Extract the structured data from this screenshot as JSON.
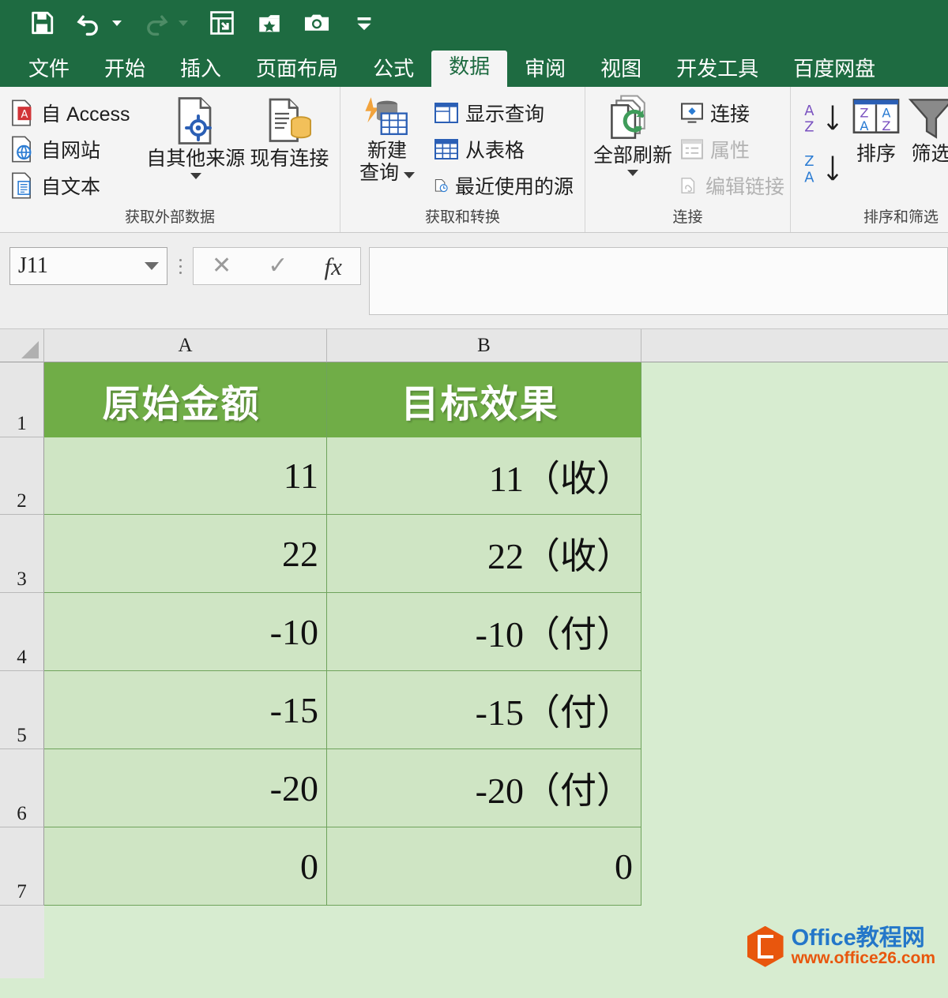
{
  "quick_access": {
    "items": [
      {
        "name": "save-icon",
        "label": "保存"
      },
      {
        "name": "undo-icon",
        "label": "撤消"
      },
      {
        "name": "redo-icon",
        "label": "恢复"
      },
      {
        "name": "export-table-icon",
        "label": "导出表格"
      },
      {
        "name": "favorites-icon",
        "label": "收藏"
      },
      {
        "name": "camera-icon",
        "label": "截图"
      },
      {
        "name": "customize-qat-icon",
        "label": "自定义快速访问工具栏"
      }
    ]
  },
  "tabs": [
    {
      "label": "文件",
      "active": false
    },
    {
      "label": "开始",
      "active": false
    },
    {
      "label": "插入",
      "active": false
    },
    {
      "label": "页面布局",
      "active": false
    },
    {
      "label": "公式",
      "active": false
    },
    {
      "label": "数据",
      "active": true
    },
    {
      "label": "审阅",
      "active": false
    },
    {
      "label": "视图",
      "active": false
    },
    {
      "label": "开发工具",
      "active": false
    },
    {
      "label": "百度网盘",
      "active": false
    }
  ],
  "ribbon": {
    "groups": [
      {
        "title": "获取外部数据",
        "small_items": [
          {
            "label": "自 Access",
            "disabled": false
          },
          {
            "label": "自网站",
            "disabled": false
          },
          {
            "label": "自文本",
            "disabled": false
          }
        ],
        "big_items": [
          {
            "label": "自其他来源",
            "label2": "",
            "has_caret": true
          },
          {
            "label": "现有连接",
            "label2": "",
            "has_caret": false
          }
        ]
      },
      {
        "title": "获取和转换",
        "small_items": [
          {
            "label": "显示查询",
            "disabled": false
          },
          {
            "label": "从表格",
            "disabled": false
          },
          {
            "label": "最近使用的源",
            "disabled": false
          }
        ],
        "big_items": [
          {
            "label": "新建",
            "label2": "查询",
            "has_caret": true
          }
        ]
      },
      {
        "title": "连接",
        "small_items": [
          {
            "label": "连接",
            "disabled": false
          },
          {
            "label": "属性",
            "disabled": true
          },
          {
            "label": "编辑链接",
            "disabled": true
          }
        ],
        "big_items": [
          {
            "label": "全部刷新",
            "label2": "",
            "has_caret": true
          }
        ]
      },
      {
        "title": "排序和筛选",
        "small_items": [],
        "big_items": [
          {
            "label": "排序",
            "label2": "",
            "has_caret": false
          },
          {
            "label": "筛选",
            "label2": "",
            "has_caret": false
          }
        ]
      }
    ]
  },
  "formula_bar": {
    "name_box_value": "J11",
    "cancel_label": "✕",
    "accept_label": "✓",
    "fx_label": "fx",
    "input_value": "",
    "input_placeholder": ""
  },
  "sheet": {
    "column_headers": [
      "A",
      "B",
      ""
    ],
    "row_headers": [
      "1",
      "2",
      "3",
      "4",
      "5",
      "6",
      "7"
    ],
    "header_fill": "#70ad47",
    "cell_fill": "#cfe5c4",
    "table_header": {
      "a": "原始金额",
      "b": "目标效果"
    },
    "rows": [
      {
        "a": "11",
        "b": "11（收）"
      },
      {
        "a": "22",
        "b": "22（收）"
      },
      {
        "a": "-10",
        "b": "-10（付）"
      },
      {
        "a": "-15",
        "b": "-15（付）"
      },
      {
        "a": "-20",
        "b": "-20（付）"
      },
      {
        "a": "0",
        "b": "0"
      }
    ]
  },
  "watermark": {
    "title": "Office教程网",
    "url": "www.office26.com",
    "logo_color": "#e8560d",
    "title_color": "#2477c9"
  }
}
